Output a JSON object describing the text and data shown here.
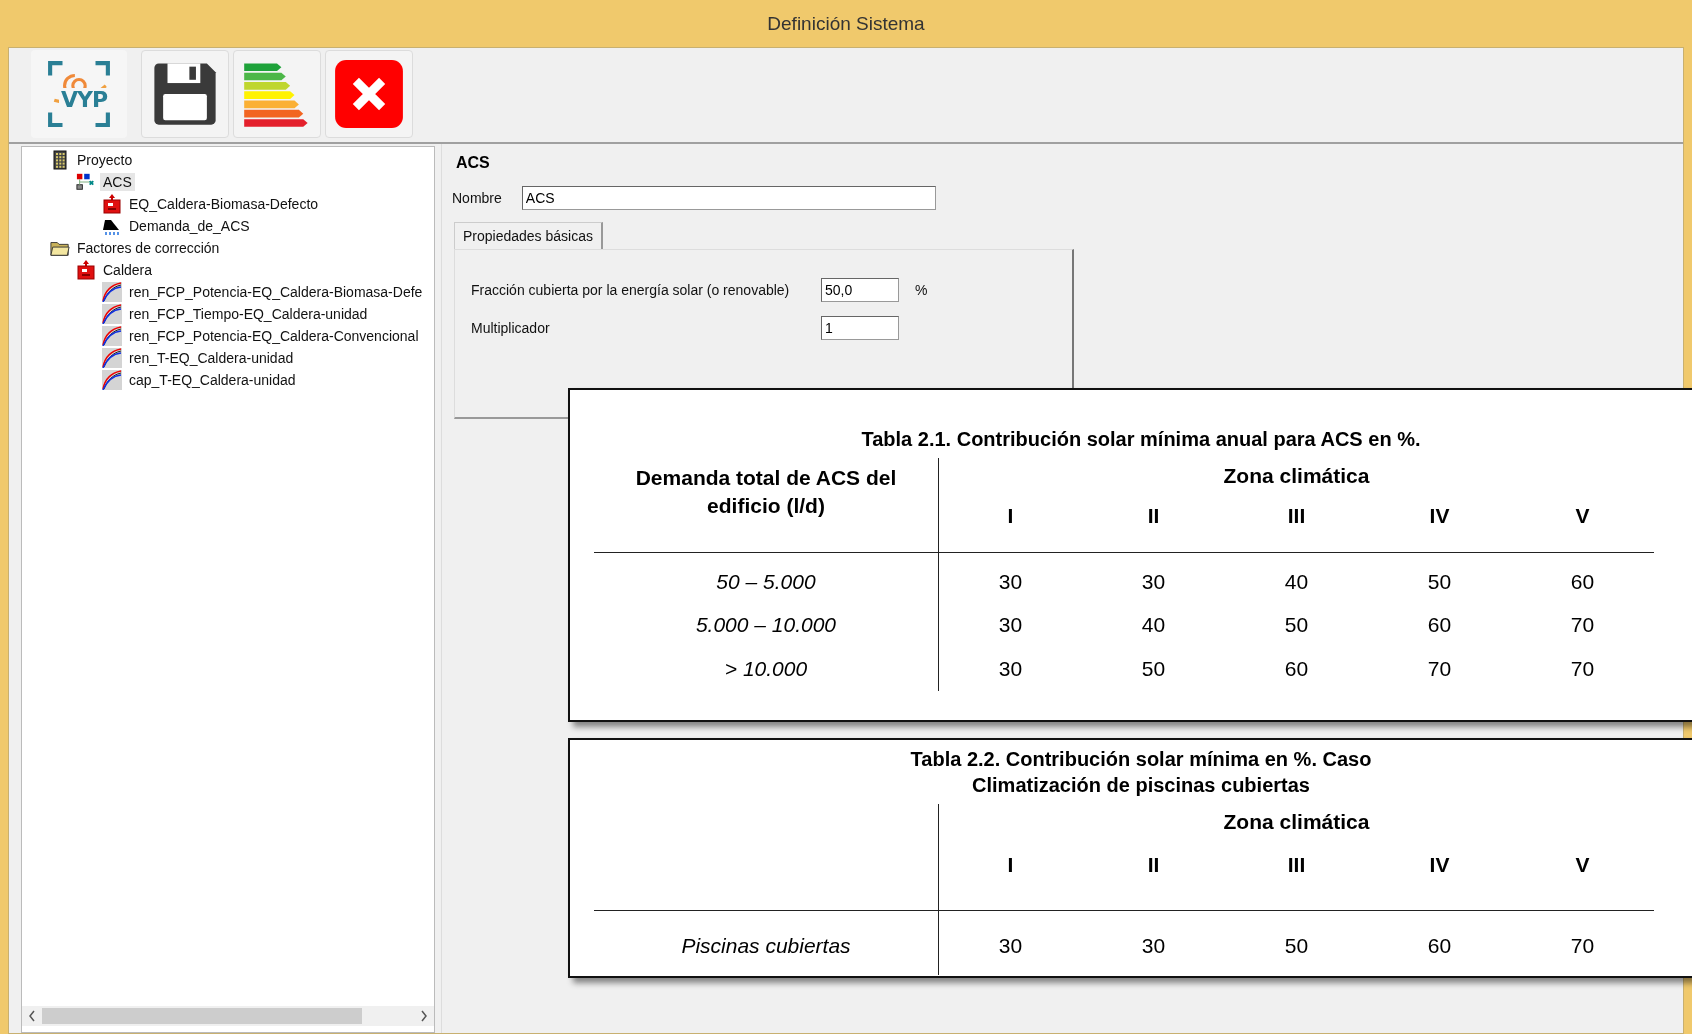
{
  "window": {
    "title": "Definición Sistema"
  },
  "toolbar": [
    {
      "kind": "logo",
      "label": "VYP"
    },
    {
      "kind": "save"
    },
    {
      "kind": "rating"
    },
    {
      "kind": "close"
    }
  ],
  "tree": [
    {
      "label": "Proyecto",
      "kind": "building",
      "selected": false,
      "children": [
        {
          "label": "ACS",
          "kind": "system",
          "selected": true,
          "children": [
            {
              "label": "EQ_Caldera-Biomasa-Defecto",
              "kind": "boiler",
              "selected": false
            },
            {
              "label": "Demanda_de_ACS",
              "kind": "shower",
              "selected": false
            }
          ]
        }
      ]
    },
    {
      "label": "Factores de corrección",
      "kind": "folder",
      "selected": false,
      "children": [
        {
          "label": "Caldera",
          "kind": "boiler",
          "selected": false,
          "children": [
            {
              "label": "ren_FCP_Potencia-EQ_Caldera-Biomasa-Defe",
              "kind": "curve",
              "selected": false
            },
            {
              "label": "ren_FCP_Tiempo-EQ_Caldera-unidad",
              "kind": "curve",
              "selected": false
            },
            {
              "label": "ren_FCP_Potencia-EQ_Caldera-Convencional",
              "kind": "curve",
              "selected": false
            },
            {
              "label": "ren_T-EQ_Caldera-unidad",
              "kind": "curve",
              "selected": false
            },
            {
              "label": "cap_T-EQ_Caldera-unidad",
              "kind": "curve",
              "selected": false
            }
          ]
        }
      ]
    }
  ],
  "form": {
    "heading": "ACS",
    "name_label": "Nombre",
    "name_value": "ACS",
    "tabs": [
      {
        "label": "Propiedades básicas",
        "selected": true
      }
    ],
    "fields": [
      {
        "label": "Fracción cubierta por la energía solar (o renovable)",
        "value": "50,0",
        "unit": "%"
      },
      {
        "label": "Multiplicador",
        "value": "1"
      }
    ]
  },
  "tables": [
    {
      "title_lines": [
        "Tabla 2.1. Contribución solar mínima anual para ACS en %."
      ],
      "row_header": "Demanda total de ACS del edificio (l/d)",
      "group_header": "Zona climática",
      "columns": [
        "I",
        "II",
        "III",
        "IV",
        "V"
      ],
      "rows": [
        {
          "label": "50 – 5.000",
          "values": [
            "30",
            "30",
            "40",
            "50",
            "60"
          ]
        },
        {
          "label": "5.000 – 10.000",
          "values": [
            "30",
            "40",
            "50",
            "60",
            "70"
          ]
        },
        {
          "label": "> 10.000",
          "values": [
            "30",
            "50",
            "60",
            "70",
            "70"
          ]
        }
      ]
    },
    {
      "title_lines": [
        "Tabla 2.2. Contribución solar mínima en %. Caso",
        "Climatización de piscinas cubiertas"
      ],
      "group_header": "Zona climática",
      "columns": [
        "I",
        "II",
        "III",
        "IV",
        "V"
      ],
      "rows": [
        {
          "label": "Piscinas cubiertas",
          "values": [
            "30",
            "30",
            "50",
            "60",
            "70"
          ]
        }
      ]
    }
  ]
}
